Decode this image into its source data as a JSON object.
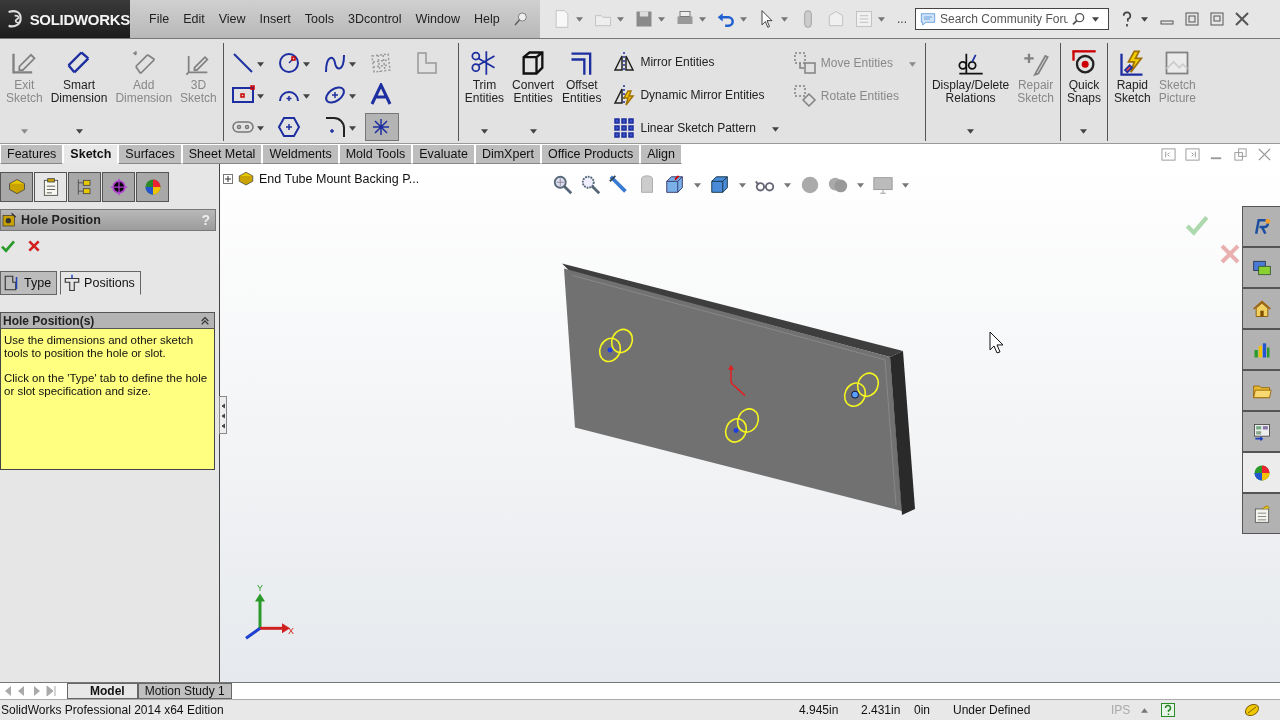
{
  "menu_bar": {
    "logo": "SOLIDWORKS",
    "menus": [
      "File",
      "Edit",
      "View",
      "Insert",
      "Tools",
      "3Dcontrol",
      "Window",
      "Help"
    ]
  },
  "quick_access": {
    "more": "...",
    "search_placeholder": "Search Community Foru"
  },
  "ribbon": {
    "groups": [
      {
        "items": [
          {
            "kind": "exit",
            "label": "Exit Sketch",
            "disabled": true,
            "dropdown": true
          },
          {
            "kind": "dimension",
            "label": "Smart Dimension",
            "disabled": false,
            "dropdown": true
          },
          {
            "kind": "adddimension",
            "label": "Add Dimension",
            "disabled": true,
            "dropdown": false
          },
          {
            "kind": "sketch3d",
            "label": "3D Sketch",
            "disabled": true,
            "dropdown": false
          }
        ]
      },
      {
        "items": [
          {
            "rows": [
              [
                {
                  "kind": "line",
                  "dropdown": true,
                  "selected": false
                },
                {
                  "kind": "circle",
                  "dropdown": true,
                  "selected": false
                },
                {
                  "kind": "spline",
                  "dropdown": true,
                  "selected": false
                },
                {
                  "kind": "grid",
                  "dropdown": false,
                  "selected": false
                },
                {
                  "kind": "corner",
                  "dropdown": false,
                  "selected": false
                }
              ],
              [
                {
                  "kind": "rect",
                  "dropdown": true,
                  "selected": false
                },
                {
                  "kind": "arc",
                  "dropdown": true,
                  "selected": false
                },
                {
                  "kind": "ellipse",
                  "dropdown": true,
                  "selected": false
                },
                {
                  "kind": "text",
                  "dropdown": false,
                  "selected": false
                }
              ],
              [
                {
                  "kind": "slot",
                  "dropdown": true,
                  "selected": false
                },
                {
                  "kind": "polygon",
                  "dropdown": false,
                  "selected": false
                },
                {
                  "kind": "fillet",
                  "dropdown": true,
                  "selected": false
                },
                {
                  "kind": "point",
                  "dropdown": false,
                  "selected": true
                }
              ]
            ]
          }
        ]
      },
      {
        "items": [
          {
            "kind": "trim",
            "label": "Trim Entities",
            "disabled": false,
            "dropdown": true
          },
          {
            "kind": "convert",
            "label": "Convert Entities",
            "disabled": false,
            "dropdown": true
          },
          {
            "kind": "offset",
            "label": "Offset Entities",
            "disabled": false,
            "dropdown": false
          },
          {
            "tools": [
              {
                "kind": "mirror",
                "label": "Mirror Entities",
                "disabled": false,
                "dropdown": false
              },
              {
                "kind": "dynmirror",
                "label": "Dynamic Mirror Entities",
                "disabled": false,
                "dropdown": false
              },
              {
                "kind": "pattern",
                "label": "Linear Sketch Pattern",
                "disabled": false,
                "dropdown": true
              }
            ]
          },
          {
            "tools": [
              {
                "kind": "move",
                "label": "Move Entities",
                "disabled": true,
                "dropdown": true
              },
              {
                "kind": "rotate",
                "label": "Rotate Entities",
                "disabled": true,
                "dropdown": false
              }
            ]
          }
        ]
      },
      {
        "items": [
          {
            "kind": "relations",
            "label": "Display/Delete Relations",
            "disabled": false,
            "dropdown": true
          },
          {
            "kind": "repair",
            "label": "Repair Sketch",
            "disabled": true,
            "dropdown": false
          }
        ]
      },
      {
        "items": [
          {
            "kind": "snaps",
            "label": "Quick Snaps",
            "disabled": false,
            "dropdown": true
          }
        ]
      },
      {
        "items": [
          {
            "kind": "rapid",
            "label": "Rapid Sketch",
            "disabled": false,
            "dropdown": false
          },
          {
            "kind": "picture",
            "label": "Sketch Picture",
            "disabled": true,
            "dropdown": false
          }
        ]
      }
    ]
  },
  "command_tabs": [
    {
      "label": "Features",
      "selected": false
    },
    {
      "label": "Sketch",
      "selected": true
    },
    {
      "label": "Surfaces",
      "selected": false
    },
    {
      "label": "Sheet Metal",
      "selected": false
    },
    {
      "label": "Weldments",
      "selected": false
    },
    {
      "label": "Mold Tools",
      "selected": false
    },
    {
      "label": "Evaluate",
      "selected": false
    },
    {
      "label": "DimXpert",
      "selected": false
    },
    {
      "label": "Office Products",
      "selected": false
    },
    {
      "label": "Align",
      "selected": false
    }
  ],
  "panel_tabs": [
    {
      "kind": "featuretree",
      "selected": false
    },
    {
      "kind": "propertymanager",
      "selected": true
    },
    {
      "kind": "configuration",
      "selected": false
    },
    {
      "kind": "dimxpert",
      "selected": false
    },
    {
      "kind": "display",
      "selected": false
    }
  ],
  "property_manager": {
    "title": "Hole Position",
    "help": "?",
    "tabs": [
      {
        "label": "Type",
        "selected": false
      },
      {
        "label": "Positions",
        "selected": true
      }
    ],
    "group": {
      "title": "Hole Position(s)",
      "expanded": true,
      "message": [
        "Use the dimensions and other sketch tools to position the hole or slot.",
        "Click on the 'Type' tab to define the hole or slot specification and size."
      ]
    }
  },
  "feature_tree": {
    "item": "End Tube Mount Backing P...",
    "expanded": false
  },
  "triad": {
    "x": "X",
    "y": "Y"
  },
  "task_pane": [
    {
      "kind": "resources",
      "selected": false
    },
    {
      "kind": "library",
      "selected": false
    },
    {
      "kind": "home",
      "selected": false
    },
    {
      "kind": "chart",
      "selected": false
    },
    {
      "kind": "folder",
      "selected": false
    },
    {
      "kind": "palette",
      "selected": false
    },
    {
      "kind": "appearances",
      "selected": true
    },
    {
      "kind": "properties",
      "selected": false
    }
  ],
  "bottom_tabs": [
    {
      "label": "Model",
      "selected": true
    },
    {
      "label": "Motion Study 1",
      "selected": false
    }
  ],
  "status_bar": {
    "edition": "SolidWorks Professional 2014 x64 Edition",
    "x": "4.945in",
    "y": "2.431in",
    "z": "0in",
    "state": "Under Defined",
    "units": "IPS"
  }
}
